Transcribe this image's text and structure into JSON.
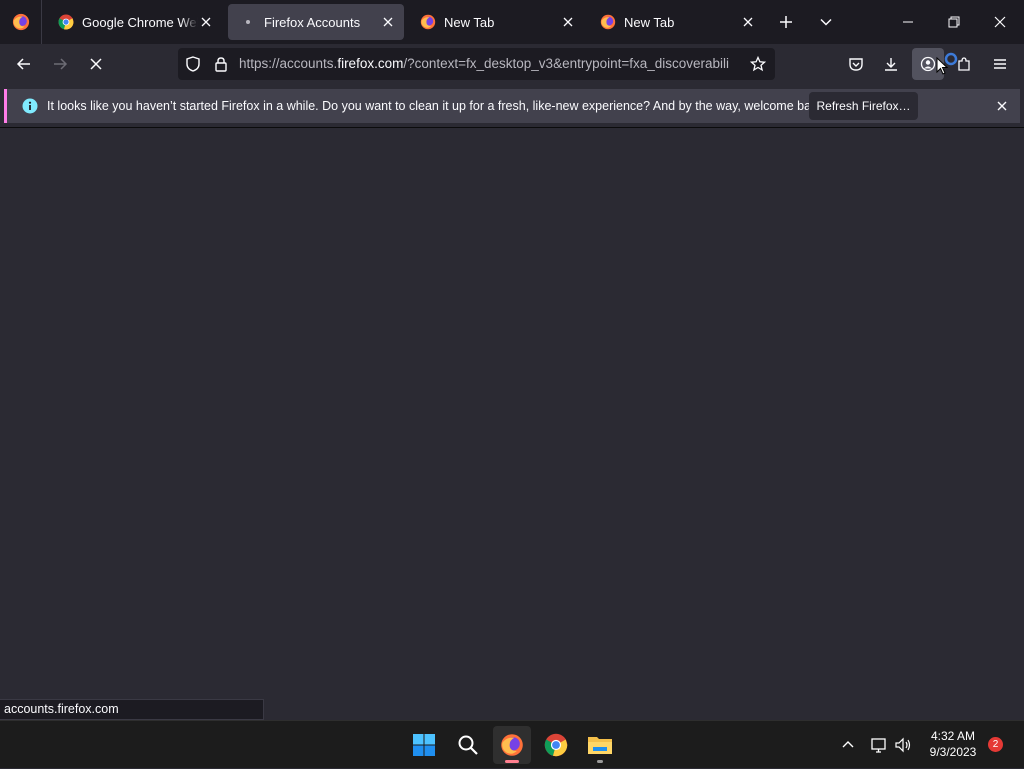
{
  "tabs": [
    {
      "title": "Google Chrome Web Store",
      "icon": "chrome-icon",
      "active": false
    },
    {
      "title": "Firefox Accounts",
      "icon": "loading-dot-icon",
      "active": true
    },
    {
      "title": "New Tab",
      "icon": "firefox-icon",
      "active": false
    },
    {
      "title": "New Tab",
      "icon": "firefox-icon",
      "active": false
    }
  ],
  "urlbar": {
    "prefix": "https://accounts.",
    "domain": "firefox.com",
    "suffix": "/?context=fx_desktop_v3&entrypoint=fxa_discoverabili"
  },
  "notification": {
    "message": "It looks like you haven’t started Firefox in a while. Do you want to clean it up for a fresh, like-new experience? And by the way, welcome back!",
    "button_label": "Refresh Firefox…"
  },
  "status": {
    "text": "accounts.firefox.com"
  },
  "taskbar": {
    "time": "4:32 AM",
    "date": "9/3/2023",
    "notification_count": "2"
  },
  "colors": {
    "accent": "#ff7de8",
    "info": "#80ebff",
    "bg": "#2b2a33",
    "toolbar": "#1c1b22"
  }
}
